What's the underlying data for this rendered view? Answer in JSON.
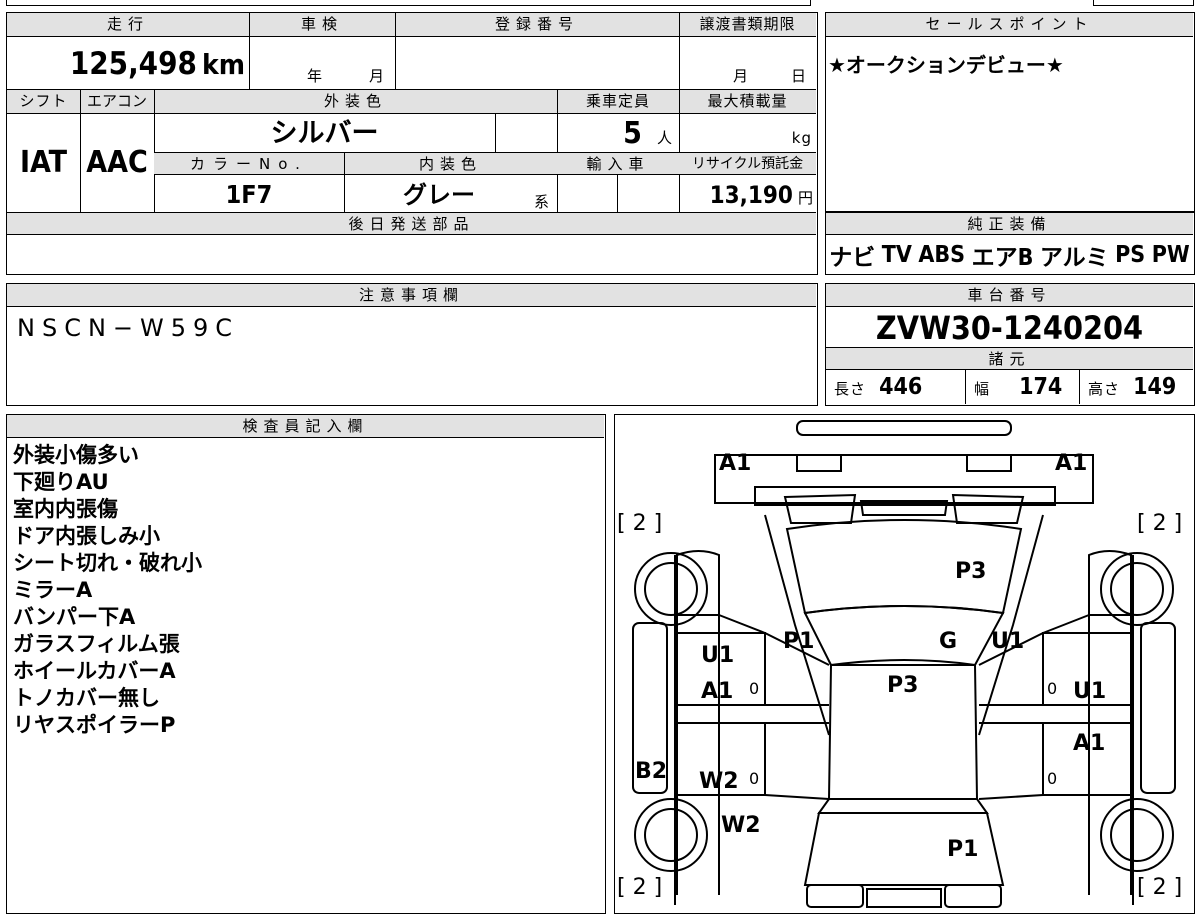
{
  "top": {
    "mileage": {
      "label": "走行",
      "value": "125,498",
      "unit": "km"
    },
    "shaken": {
      "label": "車検",
      "year_unit": "年",
      "month_unit": "月"
    },
    "registration": {
      "label": "登録番号"
    },
    "transfer_deadline": {
      "label": "譲渡書類期限",
      "month_unit": "月",
      "day_unit": "日"
    },
    "shift": {
      "label": "シフト",
      "value": "IAT"
    },
    "aircon": {
      "label": "エアコン",
      "value": "AAC"
    },
    "exterior_color": {
      "label": "外装色",
      "value": "シルバー"
    },
    "capacity": {
      "label": "乗車定員",
      "value": "5",
      "unit": "人"
    },
    "max_load": {
      "label": "最大積載量",
      "unit": "kg"
    },
    "color_no": {
      "label": "カラーNo.",
      "value": "1F7"
    },
    "interior_color": {
      "label": "内装色",
      "value": "グレー",
      "suffix": "系"
    },
    "import": {
      "label": "輸入車"
    },
    "recycle": {
      "label": "リサイクル預託金",
      "value": "13,190",
      "unit": "円"
    },
    "later_parts": {
      "label": "後日発送部品"
    }
  },
  "sales_point": {
    "label": "セールスポイント",
    "text": "★オークションデビュー★"
  },
  "equipment": {
    "label": "純正装備",
    "items": [
      "ナビ",
      "TV",
      "ABS",
      "エアB",
      "アルミ",
      "PS",
      "PW"
    ]
  },
  "notes": {
    "label": "注意事項欄",
    "text": "NSCN−W59C"
  },
  "chassis": {
    "label": "車台番号",
    "value": "ZVW30-1240204"
  },
  "specs": {
    "label": "諸元",
    "length": {
      "label": "長さ",
      "value": "446"
    },
    "width": {
      "label": "幅",
      "value": "174"
    },
    "height": {
      "label": "高さ",
      "value": "149"
    }
  },
  "inspector": {
    "label": "検査員記入欄",
    "lines": [
      "外装小傷多い",
      "下廻りAU",
      "室内内張傷",
      "ドア内張しみ小",
      "シート切れ・破れ小",
      "ミラーA",
      "バンパー下A",
      "ガラスフィルム張",
      "ホイールカバーA",
      "トノカバー無し",
      "リヤスポイラーP"
    ]
  },
  "diagram": {
    "marks": {
      "a1_left": "A1",
      "a1_right": "A1",
      "tire_tl": "[ 2 ]",
      "tire_tr": "[ 2 ]",
      "tire_bl": "[ 2 ]",
      "tire_br": "[ 2 ]",
      "p3_top": "P3",
      "p1_left": "P1",
      "g": "G",
      "u1_right_top": "U1",
      "u1_left": "U1",
      "a1_left_door": "A1",
      "p3_roof": "P3",
      "u1_right_door": "U1",
      "a1_right_door": "A1",
      "b2": "B2",
      "w2_door": "W2",
      "w2_rear": "W2",
      "p1_rear": "P1",
      "zero": "0"
    }
  }
}
